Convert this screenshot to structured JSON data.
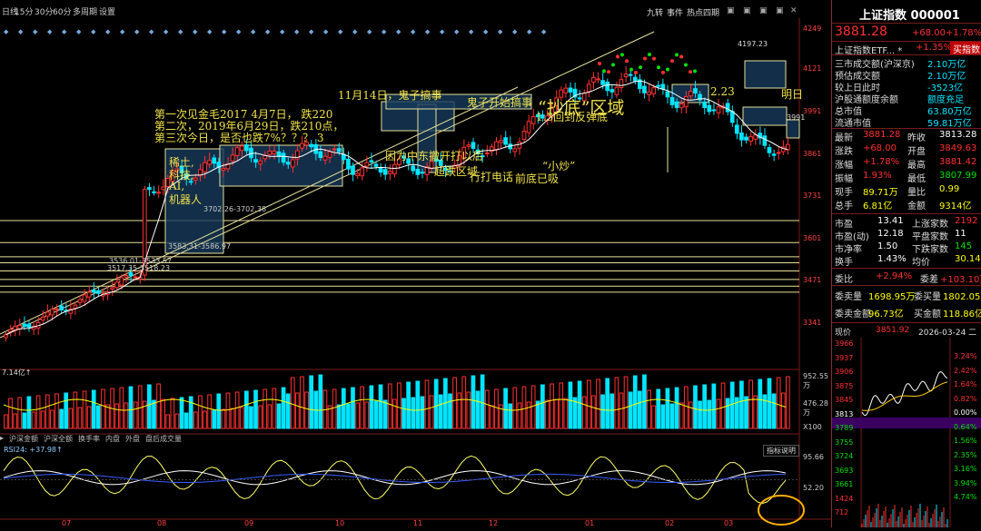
{
  "top_tabs": [
    "日线",
    "15分",
    "30分",
    "60分",
    "多周期",
    "设置"
  ],
  "top_right": [
    "九转",
    "事件",
    "热点四期",
    "图",
    "图",
    "图",
    "图"
  ],
  "price_axis": [
    "4249",
    "4121",
    "3991",
    "3861",
    "3731",
    "3601",
    "3471",
    "3341"
  ],
  "price_axis_right": "3991",
  "volume_axis": [
    "952.55万",
    "476.28万",
    "X100"
  ],
  "volume_label": "7.14亿↑",
  "rsi_axis": [
    "95.66",
    "52.20"
  ],
  "rsi_label": "RSI24: +37.98↑",
  "dates": [
    "07",
    "08",
    "09",
    "10",
    "11",
    "12",
    "01",
    "02",
    "03"
  ],
  "bottom_tabs": [
    "沪深金额",
    "沪深全额",
    "换手率",
    "内盘",
    "外盘",
    "盘后成交量"
  ],
  "indicator_button": "指标说明",
  "level_labels": {
    "l1": "3702.26-3702.38",
    "l2": "3583.31-3586.97",
    "l3": "3536.01-3533.57",
    "l4": "3517.35-3518.23",
    "peak": "4197.23"
  },
  "annotations": {
    "a1": "第一次见金毛2017   4月7日，    跌220",
    "a2": "第二次，2019年6月29日，跌210点，",
    "a3": "第三次今日，是否也跌7%？？？  3",
    "a4": "稀土,",
    "a5": "科技,",
    "a6": "AI,",
    "a7": "机器人",
    "a8": "11月14日，鬼子搞事",
    "a9": "鬼子开始搞事",
    "a10": "“抄底”区域",
    "a11": "因为中东撤开打以后",
    "a12": "超跌区域",
    "a13": "行打电话",
    "a14": "前底已吸",
    "a15": "“小炒”",
    "a16": "1.3回到反弹底",
    "a17": "2.23",
    "a18": "明日"
  },
  "panel": {
    "title": "上证指数 000001",
    "price": "3881.28",
    "change": "+68.00",
    "change_pct": "+1.78%",
    "etf_name": "上证指数ETF... *",
    "etf_pct": "+1.35%",
    "buy_btn": "买指数",
    "rows1": [
      {
        "label": "三市成交额(沪深京)",
        "value": "2.10万亿"
      },
      {
        "label": "预估成交额",
        "value": "2.10万亿"
      },
      {
        "label": "较上日此时",
        "value": "-3523亿"
      },
      {
        "label": "沪股通额度余额",
        "value": "额度充足"
      },
      {
        "label": "总市值",
        "value": "63.80万亿"
      },
      {
        "label": "流通市值",
        "value": "59.81万亿"
      }
    ],
    "quote": [
      {
        "l1": "最新",
        "v1": "3881.28",
        "l2": "昨收",
        "v2": "3813.28"
      },
      {
        "l1": "涨跌",
        "v1": "+68.00",
        "l2": "开盘",
        "v2": "3849.63"
      },
      {
        "l1": "涨幅",
        "v1": "+1.78%",
        "l2": "最高",
        "v2": "3881.42"
      },
      {
        "l1": "振幅",
        "v1": "1.93%",
        "l2": "最低",
        "v2": "3807.99"
      },
      {
        "l1": "现手",
        "v1": "89.71万",
        "l2": "量比",
        "v2": "0.99"
      },
      {
        "l1": "总手",
        "v1": "6.81亿",
        "l2": "金额",
        "v2": "9314亿"
      }
    ],
    "stats": [
      {
        "l1": "市盈",
        "v1": "13.41",
        "l2": "上涨家数",
        "v2": "2192"
      },
      {
        "l1": "市盈(动)",
        "v1": "12.18",
        "l2": "平盘家数",
        "v2": "11"
      },
      {
        "l1": "市净率",
        "v1": "1.50",
        "l2": "下跌家数",
        "v2": "145"
      },
      {
        "l1": "换手",
        "v1": "1.43%",
        "l2": "均价",
        "v2": "30.14"
      }
    ],
    "weibi": {
      "l1": "委比",
      "v1": "+2.94%",
      "l2": "委差",
      "v2": "+103.10万"
    },
    "buysell": [
      {
        "l1": "委卖量",
        "v1": "1698.95万",
        "l2": "委买量",
        "v2": "1802.05万"
      },
      {
        "l1": "委卖金额",
        "v1": "96.73亿",
        "l2": "买金额",
        "v2": "118.86亿"
      }
    ],
    "intraday_header": {
      "l": "现价",
      "price": "3851.92",
      "date": "2026-03-24 二"
    },
    "intraday_left": [
      "3966",
      "3937",
      "3906",
      "3875",
      "3845",
      "3813",
      "3789",
      "3755",
      "3724",
      "3693",
      "3661",
      "1424",
      "712"
    ],
    "intraday_right": [
      "3.24%",
      "2.42%",
      "1.64%",
      "0.82%",
      "0.00%",
      "0.64%",
      "1.56%",
      "2.35%",
      "3.16%",
      "3.94%",
      "4.74%"
    ]
  },
  "chart_data": {
    "type": "candlestick",
    "x": [
      "07",
      "08",
      "09",
      "10",
      "11",
      "12",
      "01",
      "02",
      "03"
    ],
    "close_approx": [
      3560,
      3700,
      3860,
      3900,
      3840,
      3900,
      4100,
      4050,
      3881
    ],
    "ylim": [
      3300,
      4260
    ],
    "volume_ylim": [
      0,
      952.55
    ],
    "rsi_ylim": [
      0,
      100
    ]
  }
}
